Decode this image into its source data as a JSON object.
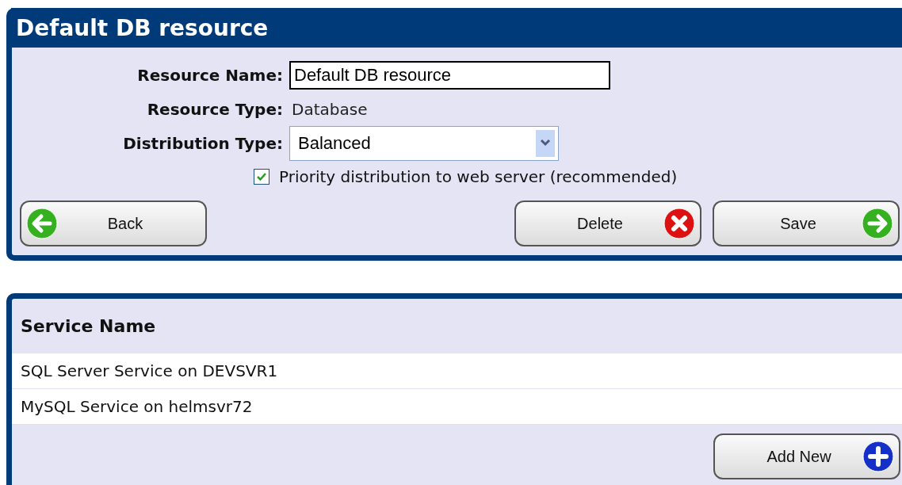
{
  "resource_panel": {
    "title": "Default DB resource",
    "fields": [
      {
        "kind": "input",
        "label": "Resource Name:",
        "value": "Default DB resource"
      },
      {
        "kind": "text",
        "label": "Resource Type:",
        "value": "Database"
      },
      {
        "kind": "select",
        "label": "Distribution Type:",
        "value": "Balanced"
      }
    ],
    "priority_checkbox": {
      "label": "Priority distribution to web server (recommended)",
      "checked": true
    },
    "buttons": [
      {
        "kind": "back",
        "label": "Back"
      },
      {
        "kind": "delete",
        "label": "Delete"
      },
      {
        "kind": "save",
        "label": "Save"
      }
    ]
  },
  "services_panel": {
    "table": {
      "columns": [
        "Service Name"
      ],
      "rows": [
        [
          "SQL Server Service on DEVSVR1"
        ],
        [
          "MySQL Service on helmsvr72"
        ]
      ]
    },
    "buttons": [
      {
        "kind": "add",
        "label": "Add New"
      }
    ]
  }
}
